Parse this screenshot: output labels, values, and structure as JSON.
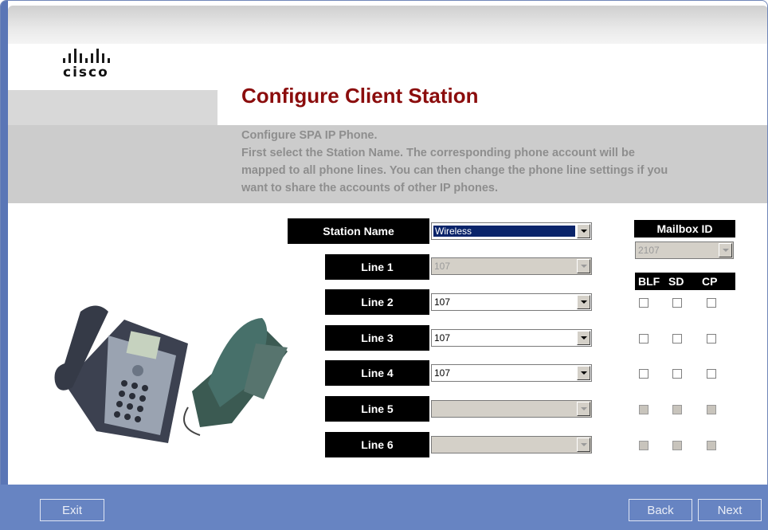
{
  "brand": {
    "logo_text": "cisco"
  },
  "page": {
    "title": "Configure Client Station",
    "description_lines": [
      "Configure SPA IP Phone.",
      "First select the Station Name. The corresponding phone account will be",
      "mapped to all phone lines. You can then change the phone line settings if you",
      "want to share the accounts of other IP phones."
    ]
  },
  "station": {
    "label": "Station Name",
    "value": "Wireless"
  },
  "mailbox": {
    "label": "Mailbox ID",
    "value": "2107"
  },
  "key_headers": {
    "blf": "BLF",
    "sd": "SD",
    "cp": "CP"
  },
  "lines": [
    {
      "label": "Line 1",
      "value": "107"
    },
    {
      "label": "Line 2",
      "value": "107"
    },
    {
      "label": "Line 3",
      "value": "107"
    },
    {
      "label": "Line 4",
      "value": "107"
    },
    {
      "label": "Line 5",
      "value": ""
    },
    {
      "label": "Line 6",
      "value": ""
    }
  ],
  "footer": {
    "exit_label": "Exit",
    "back_label": "Back",
    "next_label": "Next"
  },
  "colors": {
    "title_red": "#8b0d0d",
    "footer_blue": "#6784c2",
    "selection_blue": "#0a246a"
  }
}
